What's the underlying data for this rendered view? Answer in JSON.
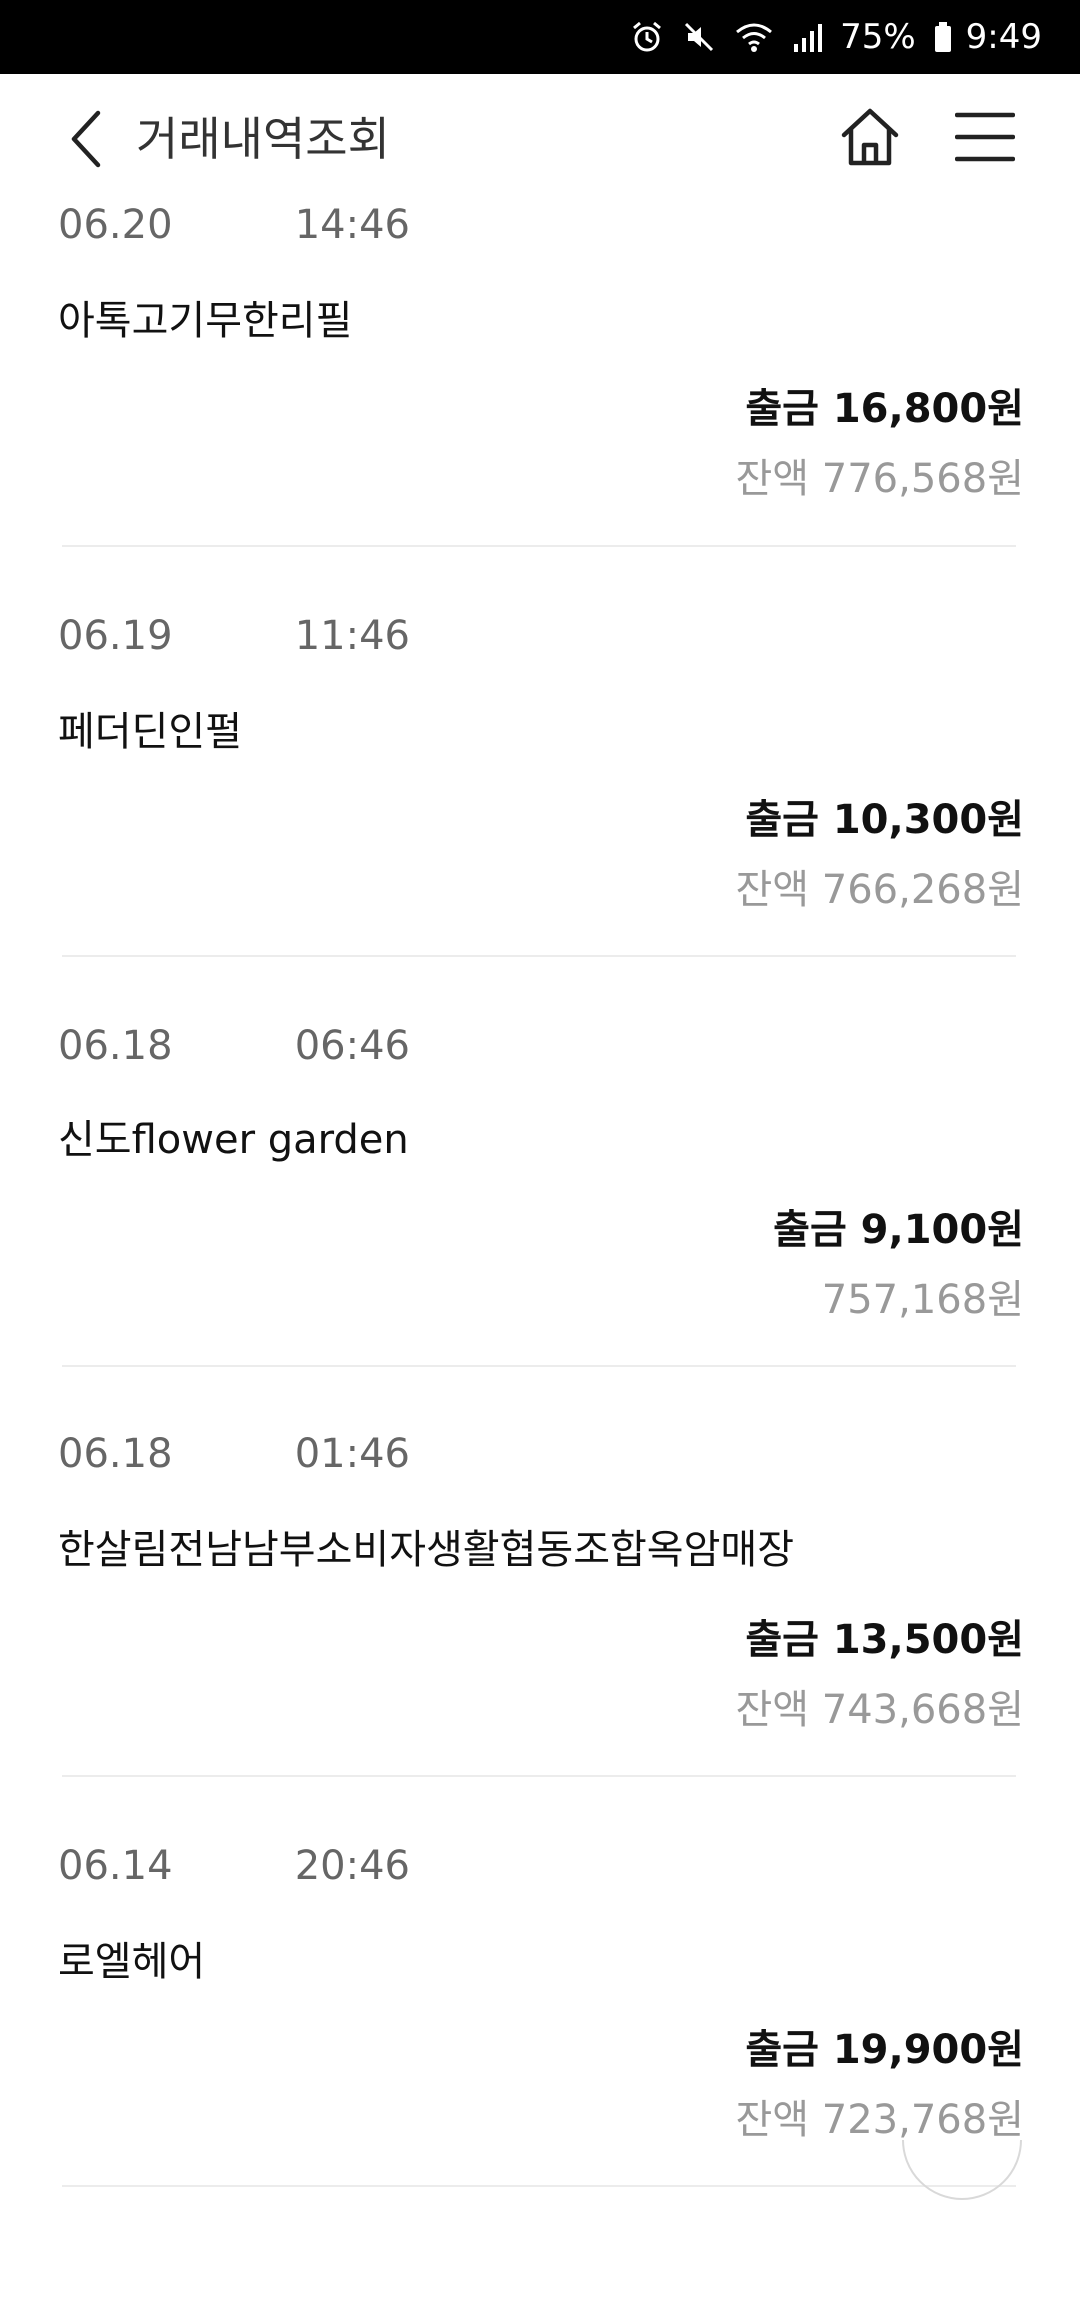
{
  "status_bar": {
    "battery": "75%",
    "time": "9:49"
  },
  "header": {
    "title": "거래내역조회"
  },
  "transactions": [
    {
      "date": "06.20",
      "time": "14:46",
      "merchant": "아톡고기무한리필",
      "amount": "출금 16,800원",
      "balance": "잔액 776,568원"
    },
    {
      "date": "06.19",
      "time": "11:46",
      "merchant": "페더딘인펄",
      "amount": "출금 10,300원",
      "balance": "잔액 766,268원"
    },
    {
      "date": "06.18",
      "time": "06:46",
      "merchant": "신도flower garden",
      "amount": "출금 9,100원",
      "balance": "757,168원"
    },
    {
      "date": "06.18",
      "time": "01:46",
      "merchant": "한살림전남남부소비자생활협동조합옥암매장",
      "amount": "출금 13,500원",
      "balance": "잔액 743,668원"
    },
    {
      "date": "06.14",
      "time": "20:46",
      "merchant": "로엘헤어",
      "amount": "출금 19,900원",
      "balance": "잔액 723,768원"
    }
  ]
}
